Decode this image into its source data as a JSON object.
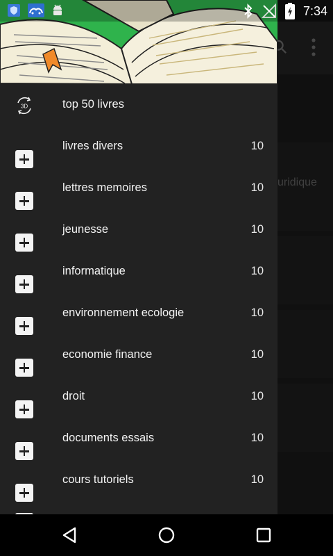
{
  "status_bar": {
    "time": "7:34",
    "left_icons": [
      "shield-app-icon",
      "cloud-sync-icon",
      "android-debug-icon"
    ],
    "right_icons": [
      "bluetooth-icon",
      "no-signal-icon",
      "battery-charging-icon"
    ]
  },
  "background": {
    "partial_text": "uridique",
    "toolbar_icons": [
      "search-icon",
      "more-vert-icon"
    ]
  },
  "drawer": {
    "header_image": "open-book-illustration",
    "top_item": {
      "label": "top 50 livres",
      "icon": "3d-rotate-icon"
    },
    "items": [
      {
        "label": "livres divers",
        "count": "10"
      },
      {
        "label": "lettres memoires",
        "count": "10"
      },
      {
        "label": "jeunesse",
        "count": "10"
      },
      {
        "label": "informatique",
        "count": "10"
      },
      {
        "label": "environnement ecologie",
        "count": "10"
      },
      {
        "label": "economie finance",
        "count": "10"
      },
      {
        "label": "droit",
        "count": "10"
      },
      {
        "label": "documents essais",
        "count": "10"
      },
      {
        "label": "cours tutoriels",
        "count": "10"
      }
    ]
  },
  "nav_bar": {
    "buttons": [
      "back-icon",
      "home-icon",
      "recents-icon"
    ]
  },
  "colors": {
    "header_green": "#2fb34c",
    "drawer_bg": "#222222",
    "scrim": "rgba(0,0,0,0.62)"
  }
}
